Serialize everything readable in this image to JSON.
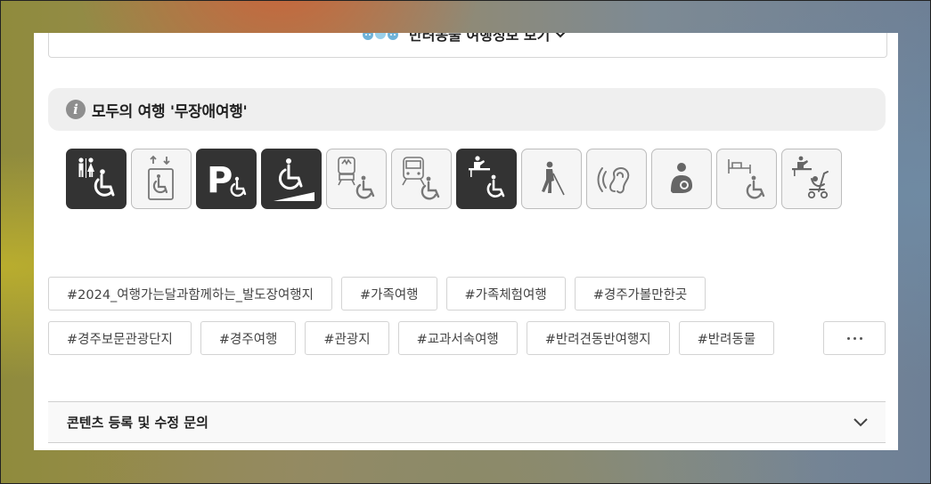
{
  "pet_info": {
    "label": "반려동물 여행정보 보기"
  },
  "accessible_travel": {
    "title": "모두의 여행 '무장애여행'",
    "info_glyph": "i"
  },
  "accessibility_icons": [
    {
      "name": "accessible-restroom-icon",
      "active": true
    },
    {
      "name": "accessible-elevator-icon",
      "active": false
    },
    {
      "name": "accessible-parking-icon",
      "active": true
    },
    {
      "name": "wheelchair-ramp-icon",
      "active": true
    },
    {
      "name": "subway-access-icon",
      "active": false
    },
    {
      "name": "train-access-icon",
      "active": false
    },
    {
      "name": "accessible-information-desk-icon",
      "active": true
    },
    {
      "name": "visual-impairment-icon",
      "active": false
    },
    {
      "name": "hearing-impairment-icon",
      "active": false
    },
    {
      "name": "nursing-room-icon",
      "active": false
    },
    {
      "name": "accessible-accommodation-icon",
      "active": false
    },
    {
      "name": "stroller-rental-icon",
      "active": false
    }
  ],
  "tags_row1": [
    "#2024_여행가는달과함께하는_발도장여행지",
    "#가족여행",
    "#가족체험여행",
    "#경주가볼만한곳"
  ],
  "tags_row2": [
    "#경주보문관광단지",
    "#경주여행",
    "#관광지",
    "#교과서속여행",
    "#반려견동반여행지",
    "#반려동물"
  ],
  "more_button": {
    "icon": "more-dots-icon"
  },
  "inquiry": {
    "label": "콘텐츠 등록 및 수정 문의"
  },
  "colors": {
    "active_icon_bg": "#333333",
    "inactive_icon_bg": "#f5f5f5",
    "title_bar_bg": "#efefef"
  }
}
